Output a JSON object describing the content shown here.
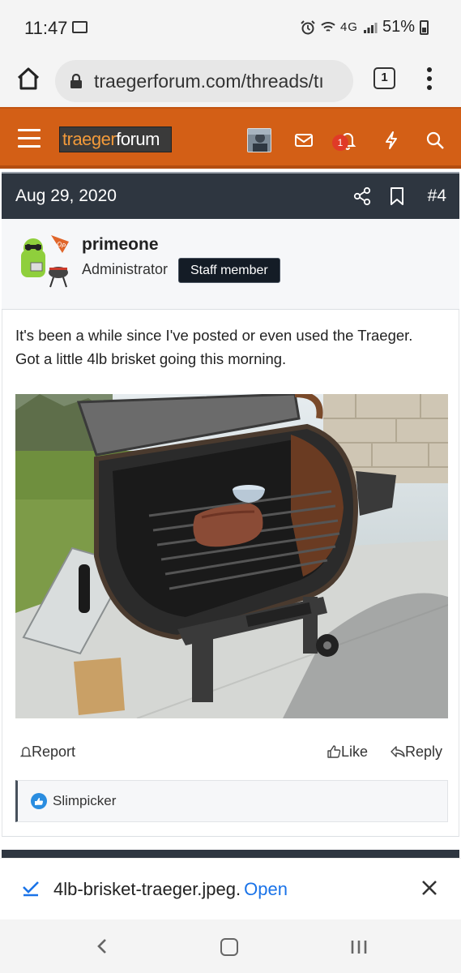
{
  "status_bar": {
    "time": "11:47",
    "network": "4G",
    "battery": "51%"
  },
  "browser": {
    "url": "traegerforum.com/threads/tı",
    "tab_count": "1"
  },
  "site_header": {
    "logo_part1": "traeger",
    "logo_part2": "forum",
    "notification_count": "1",
    "colors": {
      "header_bg": "#d35f16",
      "logo_bg": "#3a3a3a"
    }
  },
  "post": {
    "date": "Aug 29, 2020",
    "number": "#4",
    "author": {
      "name": "primeone",
      "title": "Administrator",
      "badge": "Staff member"
    },
    "text": "It's been a while since I've posted or even used the Traeger. Got a little 4lb brisket going this morning.",
    "image": "brisket-on-traeger-grill",
    "actions": {
      "report": "Report",
      "like": "Like",
      "reply": "Reply"
    },
    "reactions": {
      "users": "Slimpicker"
    }
  },
  "download": {
    "filename": "4lb-brisket-traeger.jpeg.",
    "open_label": "Open"
  }
}
